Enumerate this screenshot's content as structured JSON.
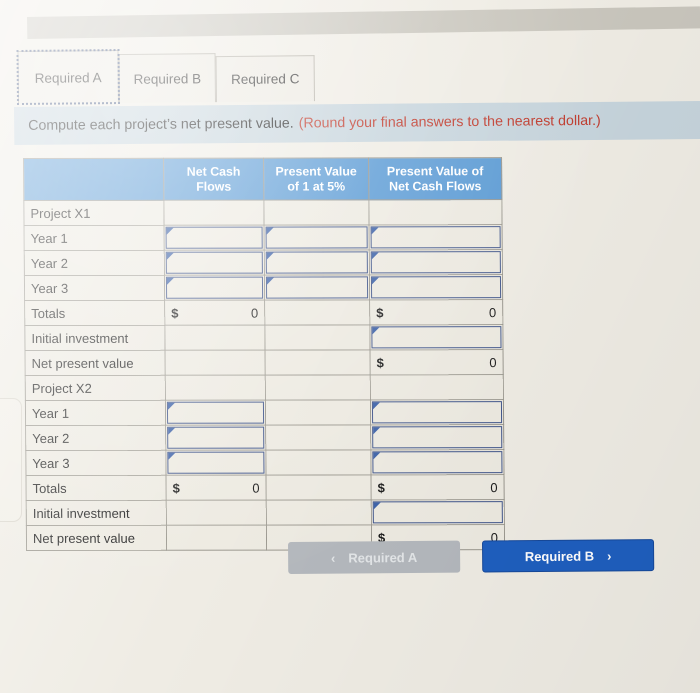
{
  "tabs": [
    {
      "label": "Required A",
      "active": true
    },
    {
      "label": "Required B",
      "active": false
    },
    {
      "label": "Required C",
      "active": false
    }
  ],
  "instruction": {
    "text": "Compute each project’s net present value.",
    "hint": "(Round your final answers to the nearest dollar.)"
  },
  "table": {
    "headers": [
      "",
      "Net Cash Flows",
      "Present Value of 1 at 5%",
      "Present Value of Net Cash Flows"
    ],
    "header_lines": {
      "col1": [
        "Net Cash",
        "Flows"
      ],
      "col2": [
        "Present Value",
        "of 1 at 5%"
      ],
      "col3": [
        "Present Value of",
        "Net Cash Flows"
      ]
    },
    "rows": [
      {
        "label": "Project X1",
        "c1": {
          "type": "blank"
        },
        "c2": {
          "type": "blank"
        },
        "c3": {
          "type": "blank"
        }
      },
      {
        "label": "Year 1",
        "c1": {
          "type": "input"
        },
        "c2": {
          "type": "input"
        },
        "c3": {
          "type": "input"
        }
      },
      {
        "label": "Year 2",
        "c1": {
          "type": "input"
        },
        "c2": {
          "type": "input"
        },
        "c3": {
          "type": "input"
        }
      },
      {
        "label": "Year 3",
        "c1": {
          "type": "input"
        },
        "c2": {
          "type": "input"
        },
        "c3": {
          "type": "input"
        }
      },
      {
        "label": "Totals",
        "c1": {
          "type": "money",
          "symbol": "$",
          "value": "0"
        },
        "c2": {
          "type": "blank"
        },
        "c3": {
          "type": "money",
          "symbol": "$",
          "value": "0"
        }
      },
      {
        "label": "Initial investment",
        "c1": {
          "type": "blank"
        },
        "c2": {
          "type": "blank"
        },
        "c3": {
          "type": "input"
        }
      },
      {
        "label": "Net present value",
        "c1": {
          "type": "blank"
        },
        "c2": {
          "type": "blank"
        },
        "c3": {
          "type": "money",
          "symbol": "$",
          "value": "0"
        }
      },
      {
        "label": "Project X2",
        "c1": {
          "type": "blank"
        },
        "c2": {
          "type": "blank"
        },
        "c3": {
          "type": "blank"
        }
      },
      {
        "label": "Year 1",
        "c1": {
          "type": "input"
        },
        "c2": {
          "type": "blank"
        },
        "c3": {
          "type": "input"
        }
      },
      {
        "label": "Year 2",
        "c1": {
          "type": "input"
        },
        "c2": {
          "type": "blank"
        },
        "c3": {
          "type": "input"
        }
      },
      {
        "label": "Year 3",
        "c1": {
          "type": "input"
        },
        "c2": {
          "type": "blank"
        },
        "c3": {
          "type": "input"
        }
      },
      {
        "label": "Totals",
        "c1": {
          "type": "money",
          "symbol": "$",
          "value": "0"
        },
        "c2": {
          "type": "blank"
        },
        "c3": {
          "type": "money",
          "symbol": "$",
          "value": "0"
        }
      },
      {
        "label": "Initial investment",
        "c1": {
          "type": "blank"
        },
        "c2": {
          "type": "blank"
        },
        "c3": {
          "type": "input"
        }
      },
      {
        "label": "Net present value",
        "c1": {
          "type": "blank"
        },
        "c2": {
          "type": "blank"
        },
        "c3": {
          "type": "money",
          "symbol": "$",
          "value": "0"
        }
      }
    ]
  },
  "footer": {
    "prev_label": "Required A",
    "prev_icon": "chevron-left-icon",
    "prev_glyph": "‹",
    "next_label": "Required B",
    "next_icon": "chevron-right-icon",
    "next_glyph": "›"
  },
  "colors": {
    "header_blue": "#5b9bd5",
    "primary_button": "#1f5fbf",
    "disabled_button": "#b4b8bd",
    "instruction_bar": "#c6d4dc",
    "hint_red": "#c0392b",
    "input_border": "#42578c",
    "page_background": "#efece4"
  }
}
